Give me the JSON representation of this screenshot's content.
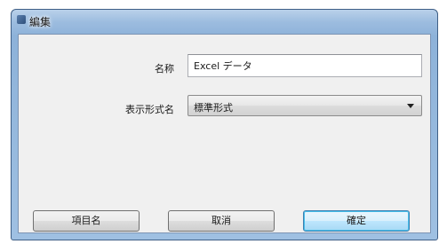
{
  "window": {
    "title": "編集"
  },
  "form": {
    "name_label": "名称",
    "name_value": "Excel データ",
    "display_label": "表示形式名",
    "display_value": "標準形式"
  },
  "buttons": {
    "fields_label": "項目名",
    "cancel_label": "取消",
    "ok_label": "確定"
  },
  "colors": {
    "titlebar": "#9cbcdf",
    "client_background": "#f0f0f0",
    "default_button_border": "#3c7fb1"
  }
}
